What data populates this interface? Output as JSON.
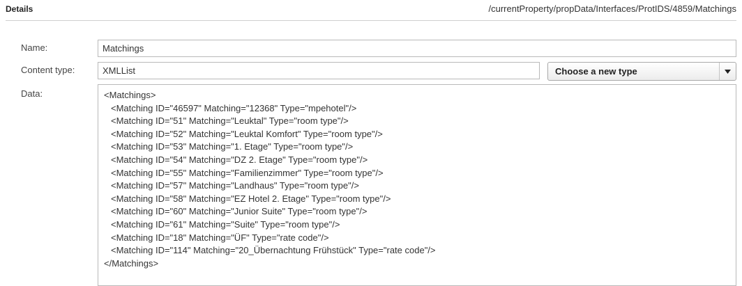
{
  "header": {
    "title": "Details",
    "path": "/currentProperty/propData/Interfaces/ProtIDS/4859/Matchings"
  },
  "form": {
    "name_label": "Name:",
    "name_value": "Matchings",
    "content_type_label": "Content type:",
    "content_type_value": "XMLList",
    "type_select_label": "Choose a new type",
    "type_select_icon": "chevron-down-icon",
    "data_label": "Data:"
  },
  "data_lines": [
    "<Matchings>",
    "<Matching ID=\"46597\" Matching=\"12368\" Type=\"mpehotel\"/>",
    "<Matching ID=\"51\" Matching=\"Leuktal\" Type=\"room type\"/>",
    "<Matching ID=\"52\" Matching=\"Leuktal Komfort\" Type=\"room type\"/>",
    "<Matching ID=\"53\" Matching=\"1. Etage\" Type=\"room type\"/>",
    "<Matching ID=\"54\" Matching=\"DZ 2. Etage\" Type=\"room type\"/>",
    "<Matching ID=\"55\" Matching=\"Familienzimmer\" Type=\"room type\"/>",
    "<Matching ID=\"57\" Matching=\"Landhaus\" Type=\"room type\"/>",
    "<Matching ID=\"58\" Matching=\"EZ Hotel 2. Etage\" Type=\"room type\"/>",
    "<Matching ID=\"60\" Matching=\"Junior Suite\" Type=\"room type\"/>",
    "<Matching ID=\"61\" Matching=\"Suite\" Type=\"room type\"/>",
    "<Matching ID=\"18\" Matching=\"ÜF\" Type=\"rate code\"/>",
    "<Matching ID=\"114\" Matching=\"20_Übernachtung Frühstück\" Type=\"rate code\"/>",
    "</Matchings>"
  ]
}
